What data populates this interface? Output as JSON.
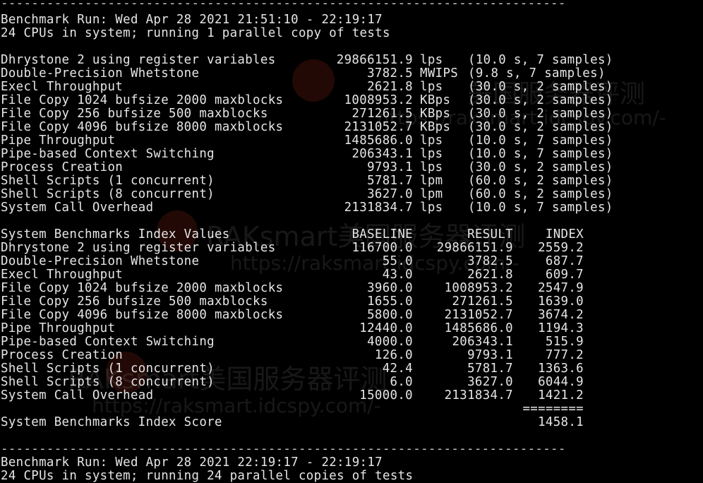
{
  "rule_top": "--------------------------------------------------------------------------",
  "rule_mid": "--------------------------------------------------------------------------",
  "run1": {
    "header": "Benchmark Run: Wed Apr 28 2021 21:51:10 - 22:19:17",
    "cpus": "24 CPUs in system; running 1 parallel copy of tests"
  },
  "results": [
    {
      "name": "Dhrystone 2 using register variables",
      "value": "29866151.9",
      "unit": "lps",
      "detail": "(10.0 s, 7 samples)"
    },
    {
      "name": "Double-Precision Whetstone",
      "value": "3782.5",
      "unit": "MWIPS",
      "detail": "(9.8 s, 7 samples)"
    },
    {
      "name": "Execl Throughput",
      "value": "2621.8",
      "unit": "lps",
      "detail": "(30.0 s, 2 samples)"
    },
    {
      "name": "File Copy 1024 bufsize 2000 maxblocks",
      "value": "1008953.2",
      "unit": "KBps",
      "detail": "(30.0 s, 2 samples)"
    },
    {
      "name": "File Copy 256 bufsize 500 maxblocks",
      "value": "271261.5",
      "unit": "KBps",
      "detail": "(30.0 s, 2 samples)"
    },
    {
      "name": "File Copy 4096 bufsize 8000 maxblocks",
      "value": "2131052.7",
      "unit": "KBps",
      "detail": "(30.0 s, 2 samples)"
    },
    {
      "name": "Pipe Throughput",
      "value": "1485686.0",
      "unit": "lps",
      "detail": "(10.0 s, 7 samples)"
    },
    {
      "name": "Pipe-based Context Switching",
      "value": "206343.1",
      "unit": "lps",
      "detail": "(10.0 s, 7 samples)"
    },
    {
      "name": "Process Creation",
      "value": "9793.1",
      "unit": "lps",
      "detail": "(30.0 s, 2 samples)"
    },
    {
      "name": "Shell Scripts (1 concurrent)",
      "value": "5781.7",
      "unit": "lpm",
      "detail": "(60.0 s, 2 samples)"
    },
    {
      "name": "Shell Scripts (8 concurrent)",
      "value": "3627.0",
      "unit": "lpm",
      "detail": "(60.0 s, 2 samples)"
    },
    {
      "name": "System Call Overhead",
      "value": "2131834.7",
      "unit": "lps",
      "detail": "(10.0 s, 7 samples)"
    }
  ],
  "index_table": {
    "title": "System Benchmarks Index Values",
    "col_baseline": "BASELINE",
    "col_result": "RESULT",
    "col_index": "INDEX",
    "rows": [
      {
        "name": "Dhrystone 2 using register variables",
        "baseline": "116700.0",
        "result": "29866151.9",
        "index": "2559.2"
      },
      {
        "name": "Double-Precision Whetstone",
        "baseline": "55.0",
        "result": "3782.5",
        "index": "687.7"
      },
      {
        "name": "Execl Throughput",
        "baseline": "43.0",
        "result": "2621.8",
        "index": "609.7"
      },
      {
        "name": "File Copy 1024 bufsize 2000 maxblocks",
        "baseline": "3960.0",
        "result": "1008953.2",
        "index": "2547.9"
      },
      {
        "name": "File Copy 256 bufsize 500 maxblocks",
        "baseline": "1655.0",
        "result": "271261.5",
        "index": "1639.0"
      },
      {
        "name": "File Copy 4096 bufsize 8000 maxblocks",
        "baseline": "5800.0",
        "result": "2131052.7",
        "index": "3674.2"
      },
      {
        "name": "Pipe Throughput",
        "baseline": "12440.0",
        "result": "1485686.0",
        "index": "1194.3"
      },
      {
        "name": "Pipe-based Context Switching",
        "baseline": "4000.0",
        "result": "206343.1",
        "index": "515.9"
      },
      {
        "name": "Process Creation",
        "baseline": "126.0",
        "result": "9793.1",
        "index": "777.2"
      },
      {
        "name": "Shell Scripts (1 concurrent)",
        "baseline": "42.4",
        "result": "5781.7",
        "index": "1363.6"
      },
      {
        "name": "Shell Scripts (8 concurrent)",
        "baseline": "6.0",
        "result": "3627.0",
        "index": "6044.9"
      },
      {
        "name": "System Call Overhead",
        "baseline": "15000.0",
        "result": "2131834.7",
        "index": "1421.2"
      }
    ],
    "separator": "========",
    "score_label": "System Benchmarks Index Score",
    "score_value": "1458.1"
  },
  "run2": {
    "header": "Benchmark Run: Wed Apr 28 2021 22:19:17 - 22:19:17",
    "cpus": "24 CPUs in system; running 24 parallel copies of tests"
  },
  "watermark": {
    "brand_cn": "美国服务器评测",
    "brand": "RAKsmart美国服务器评测",
    "url": "https://raksmart.idcspy.com/",
    "url_short": "https://raksmart.idcspy.com/-"
  }
}
